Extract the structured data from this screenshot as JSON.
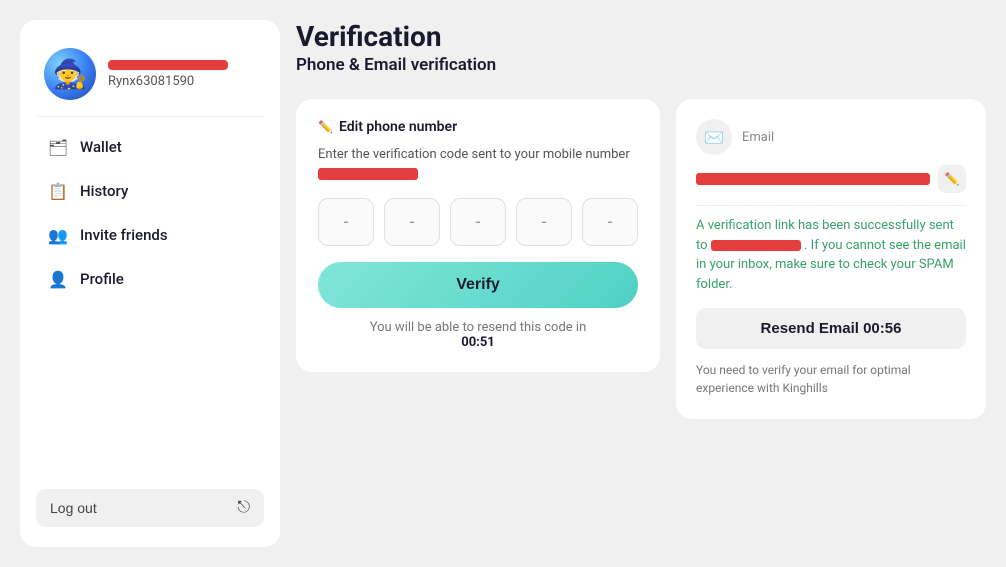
{
  "sidebar": {
    "username": "Rynx63081590",
    "nav_items": [
      {
        "id": "wallet",
        "label": "Wallet",
        "icon": "🗂"
      },
      {
        "id": "history",
        "label": "History",
        "icon": "📋"
      },
      {
        "id": "invite",
        "label": "Invite friends",
        "icon": "👥"
      },
      {
        "id": "profile",
        "label": "Profile",
        "icon": "👤"
      }
    ],
    "logout_label": "Log out"
  },
  "page": {
    "title": "Verification",
    "subtitle": "Phone & Email verification"
  },
  "phone_card": {
    "edit_label": "Edit phone number",
    "instruction": "Enter the verification code sent to your mobile number",
    "verify_button": "Verify",
    "resend_prefix": "You will be able to resend this code in",
    "resend_timer": "00:51",
    "code_placeholder": "-"
  },
  "email_card": {
    "email_label": "Email",
    "verification_message_prefix": "A verification link has been successfully sent to",
    "verification_message_suffix": ". If you cannot see the email in your inbox, make sure to check your SPAM folder.",
    "resend_button": "Resend Email 00:56",
    "footer_text": "You need to verify your email for optimal experience with Kinghills"
  }
}
